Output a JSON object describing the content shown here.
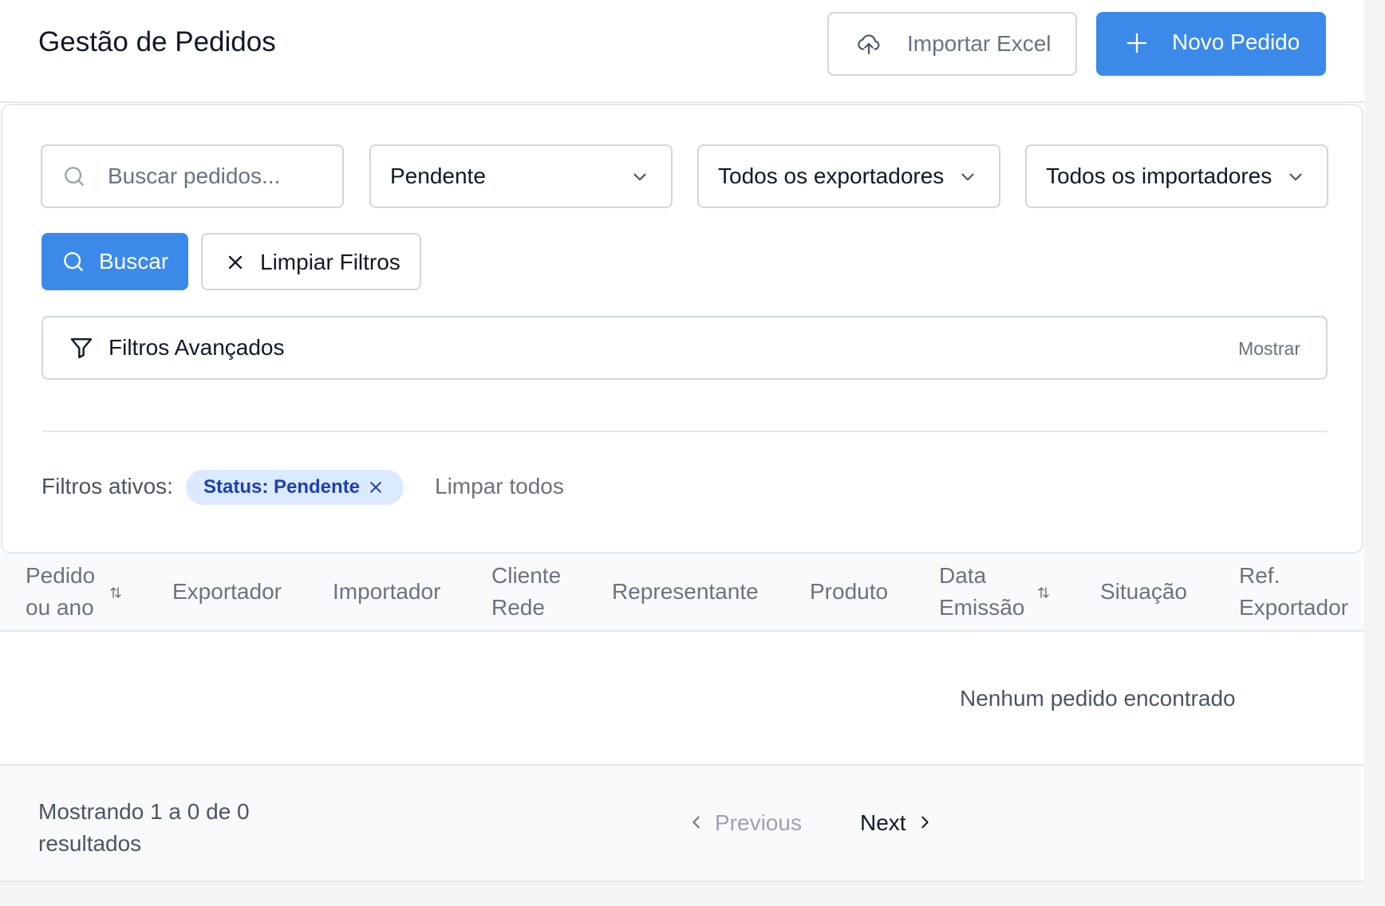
{
  "header": {
    "title": "Gestão de Pedidos",
    "import_label": "Importar Excel",
    "new_label": "Novo Pedido"
  },
  "filters": {
    "search_placeholder": "Buscar pedidos...",
    "status_value": "Pendente",
    "exporter_value": "Todos os exportadores",
    "importer_value": "Todos os importadores",
    "search_button": "Buscar",
    "clear_button": "Limpiar Filtros",
    "advanced_label": "Filtros Avançados",
    "advanced_toggle": "Mostrar",
    "active_label": "Filtros ativos:",
    "active_chip": "Status: Pendente",
    "clear_all": "Limpar todos"
  },
  "table": {
    "columns": [
      {
        "line1": "Pedido",
        "line2": "ou ano",
        "sortable": true
      },
      {
        "line1": "Exportador",
        "line2": "",
        "sortable": false
      },
      {
        "line1": "Importador",
        "line2": "",
        "sortable": false
      },
      {
        "line1": "Cliente",
        "line2": "Rede",
        "sortable": false
      },
      {
        "line1": "Representante",
        "line2": "",
        "sortable": false
      },
      {
        "line1": "Produto",
        "line2": "",
        "sortable": false
      },
      {
        "line1": "Data",
        "line2": "Emissão",
        "sortable": true
      },
      {
        "line1": "Situação",
        "line2": "",
        "sortable": false
      },
      {
        "line1": "Ref.",
        "line2": "Exportador",
        "sortable": false
      }
    ],
    "empty_message": "Nenhum pedido encontrado"
  },
  "pagination": {
    "results_line1": "Mostrando 1 a 0 de 0",
    "results_line2": "resultados",
    "previous": "Previous",
    "next": "Next"
  },
  "colors": {
    "primary": "#3b8aea",
    "chip_bg": "#dbeafe",
    "chip_text": "#1e40af"
  }
}
